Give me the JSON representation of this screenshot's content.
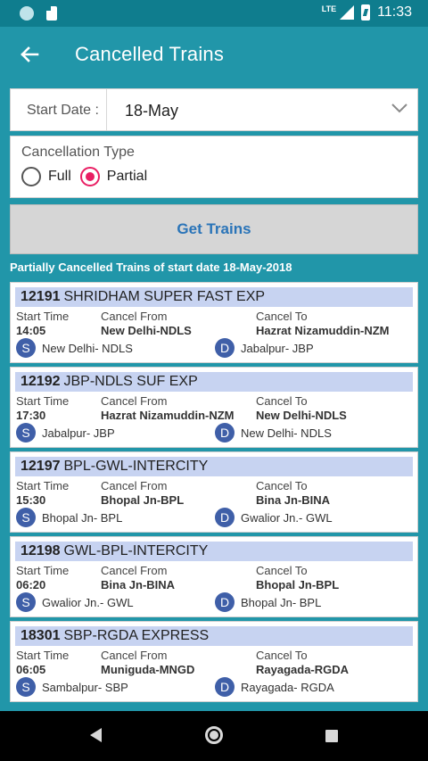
{
  "status_bar": {
    "network": "LTE",
    "time": "11:33"
  },
  "app_bar": {
    "title": "Cancelled Trains"
  },
  "start_date": {
    "label": "Start Date :",
    "value": "18-May"
  },
  "cancellation_type": {
    "label": "Cancellation Type",
    "options": [
      {
        "label": "Full",
        "selected": false
      },
      {
        "label": "Partial",
        "selected": true
      }
    ]
  },
  "get_button": {
    "label": "Get Trains"
  },
  "results": {
    "heading": "Partially Cancelled Trains of start date 18-May-2018",
    "labels": {
      "start_time": "Start Time",
      "cancel_from": "Cancel From",
      "cancel_to": "Cancel To",
      "source_badge": "S",
      "dest_badge": "D"
    },
    "trains": [
      {
        "number": "12191",
        "name": "SHRIDHAM SUPER FAST EXP",
        "start_time": "14:05",
        "cancel_from": "New Delhi-NDLS",
        "cancel_to": "Hazrat Nizamuddin-NZM",
        "source": "New Delhi- NDLS",
        "destination": "Jabalpur- JBP"
      },
      {
        "number": "12192",
        "name": "JBP-NDLS SUF EXP",
        "start_time": "17:30",
        "cancel_from": "Hazrat Nizamuddin-NZM",
        "cancel_to": "New Delhi-NDLS",
        "source": "Jabalpur- JBP",
        "destination": "New Delhi- NDLS"
      },
      {
        "number": "12197",
        "name": "BPL-GWL-INTERCITY",
        "start_time": "15:30",
        "cancel_from": "Bhopal  Jn-BPL",
        "cancel_to": "Bina Jn-BINA",
        "source": "Bhopal  Jn- BPL",
        "destination": "Gwalior Jn.- GWL"
      },
      {
        "number": "12198",
        "name": "GWL-BPL-INTERCITY",
        "start_time": "06:20",
        "cancel_from": "Bina Jn-BINA",
        "cancel_to": "Bhopal  Jn-BPL",
        "source": "Gwalior Jn.- GWL",
        "destination": "Bhopal  Jn- BPL"
      },
      {
        "number": "18301",
        "name": "SBP-RGDA EXPRESS",
        "start_time": "06:05",
        "cancel_from": "Muniguda-MNGD",
        "cancel_to": "Rayagada-RGDA",
        "source": "Sambalpur- SBP",
        "destination": "Rayagada- RGDA"
      }
    ]
  },
  "colors": {
    "primary": "#2196a9",
    "status_bar": "#0f7d8e",
    "accent": "#e91e63",
    "card_header": "#c7d3f1",
    "station_badge": "#3f5fa8",
    "button_text": "#2a74b8"
  },
  "icons": {
    "back": "arrow-left-icon",
    "dropdown": "chevron-down-icon"
  }
}
